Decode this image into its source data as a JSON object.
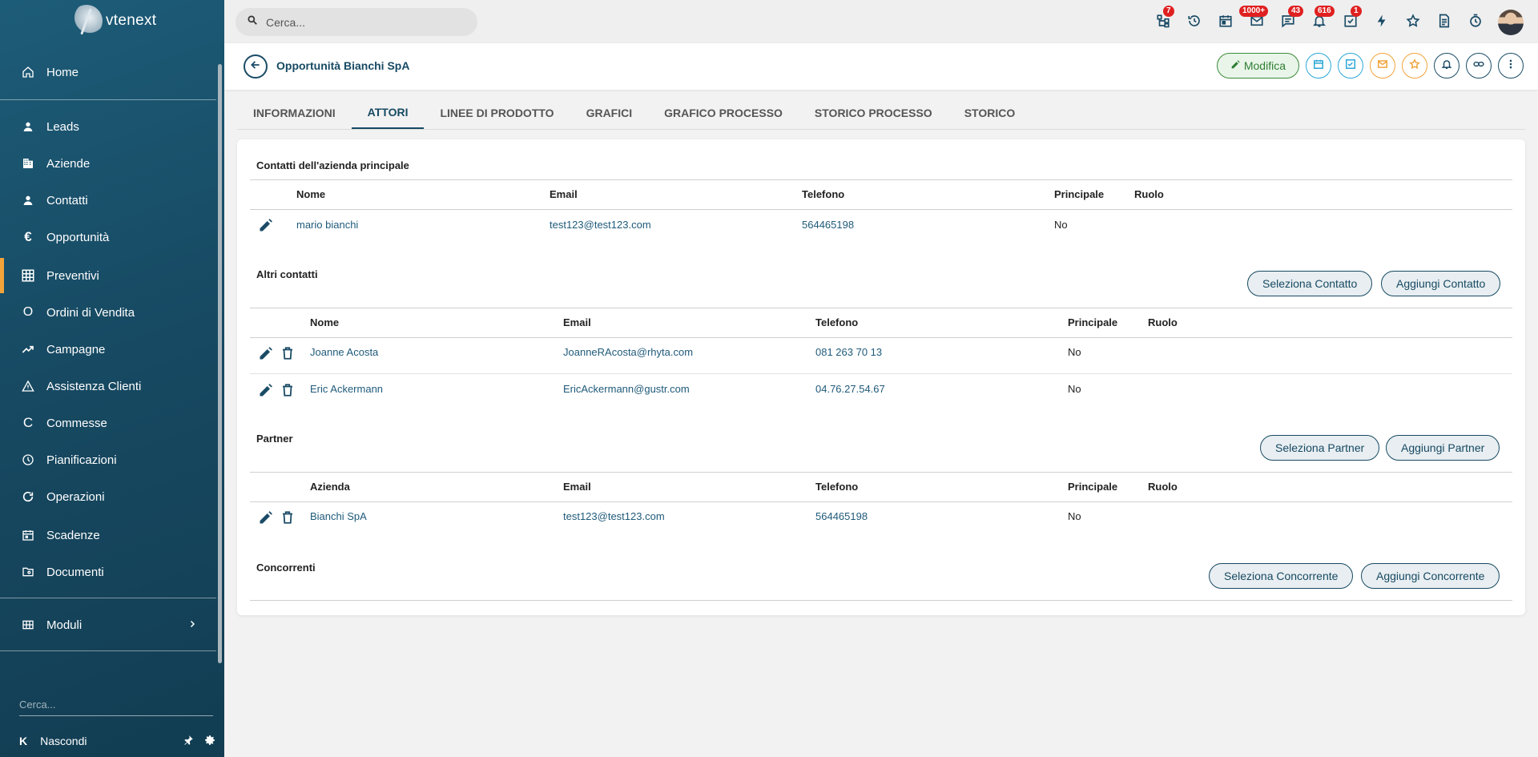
{
  "app": {
    "logo_text": "vtenext"
  },
  "sidebar": {
    "items": [
      {
        "label": "Home",
        "icon": "home-icon"
      },
      {
        "label": "Leads",
        "icon": "person-icon"
      },
      {
        "label": "Aziende",
        "icon": "building-icon"
      },
      {
        "label": "Contatti",
        "icon": "person-icon"
      },
      {
        "label": "Opportunità",
        "icon": "euro-icon"
      },
      {
        "label": "Preventivi",
        "icon": "calculator-icon"
      },
      {
        "label": "Ordini di Vendita",
        "icon": "circle-o-icon"
      },
      {
        "label": "Campagne",
        "icon": "trending-up-icon"
      },
      {
        "label": "Assistenza Clienti",
        "icon": "warning-icon"
      },
      {
        "label": "Commesse",
        "icon": "c-icon"
      },
      {
        "label": "Pianificazioni",
        "icon": "clock-icon"
      },
      {
        "label": "Operazioni",
        "icon": "refresh-icon"
      },
      {
        "label": "Scadenze",
        "icon": "calendar-icon"
      },
      {
        "label": "Documenti",
        "icon": "folder-icon"
      },
      {
        "label": "Moduli",
        "icon": "grid-icon"
      }
    ],
    "search_placeholder": "Cerca...",
    "hide_label": "Nascondi"
  },
  "header": {
    "search_placeholder": "Cerca...",
    "badges": {
      "processes": "7",
      "mail": "1000+",
      "messages": "43",
      "notifications": "616",
      "tasks": "1"
    }
  },
  "record": {
    "title": "Opportunità Bianchi SpA",
    "edit_label": "Modifica"
  },
  "tabs": [
    "INFORMAZIONI",
    "ATTORI",
    "LINEE DI PRODOTTO",
    "GRAFICI",
    "GRAFICO PROCESSO",
    "STORICO PROCESSO",
    "STORICO"
  ],
  "sections": {
    "main_contacts": {
      "title": "Contatti dell'azienda principale",
      "headers": [
        "Nome",
        "Email",
        "Telefono",
        "Principale",
        "Ruolo"
      ],
      "rows": [
        {
          "name": "mario bianchi",
          "email": "test123@test123.com",
          "phone": "564465198",
          "principal": "No"
        }
      ]
    },
    "other_contacts": {
      "title": "Altri contatti",
      "select_label": "Seleziona Contatto",
      "add_label": "Aggiungi Contatto",
      "headers": [
        "Nome",
        "Email",
        "Telefono",
        "Principale",
        "Ruolo"
      ],
      "rows": [
        {
          "name": "Joanne Acosta",
          "email": "JoanneRAcosta@rhyta.com",
          "phone": "081 263 70 13",
          "principal": "No"
        },
        {
          "name": "Eric Ackermann",
          "email": "EricAckermann@gustr.com",
          "phone": "04.76.27.54.67",
          "principal": "No"
        }
      ]
    },
    "partner": {
      "title": "Partner",
      "select_label": "Seleziona Partner",
      "add_label": "Aggiungi Partner",
      "headers": [
        "Azienda",
        "Email",
        "Telefono",
        "Principale",
        "Ruolo"
      ],
      "rows": [
        {
          "name": "Bianchi SpA",
          "email": "test123@test123.com",
          "phone": "564465198",
          "principal": "No"
        }
      ]
    },
    "competitors": {
      "title": "Concorrenti",
      "select_label": "Seleziona Concorrente",
      "add_label": "Aggiungi Concorrente"
    }
  }
}
